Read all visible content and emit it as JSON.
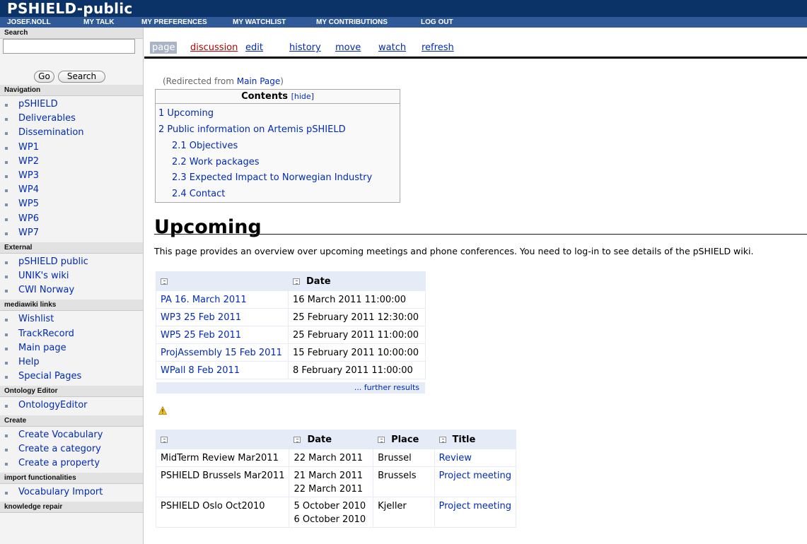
{
  "header": {
    "site_title": "PSHIELD-public",
    "personal": [
      "JOSEF.NOLL",
      "MY TALK",
      "MY PREFERENCES",
      "MY WATCHLIST",
      "MY CONTRIBUTIONS",
      "LOG OUT"
    ]
  },
  "sidebar": {
    "search": {
      "header": "Search",
      "go": "Go",
      "search": "Search",
      "value": ""
    },
    "navigation": {
      "header": "Navigation",
      "items": [
        "pSHIELD",
        "Deliverables",
        "Dissemination",
        "WP1",
        "WP2",
        "WP3",
        "WP4",
        "WP5",
        "WP6",
        "WP7"
      ]
    },
    "external": {
      "header": "External",
      "items": [
        "pSHIELD public",
        "UNIK's wiki",
        "CWI Norway"
      ]
    },
    "mediawiki": {
      "header": "mediawiki links",
      "items": [
        "Wishlist",
        "TrackRecord",
        "Main page",
        "Help",
        "Special Pages"
      ]
    },
    "ontology": {
      "header": "Ontology Editor",
      "items": [
        "OntologyEditor"
      ]
    },
    "create": {
      "header": "Create",
      "items": [
        "Create Vocabulary",
        "Create a category",
        "Create a property"
      ]
    },
    "import": {
      "header": "import functionalities",
      "items": [
        "Vocabulary Import"
      ]
    },
    "knowledge": {
      "header": "knowledge repair"
    }
  },
  "tabs": [
    "page",
    "discussion",
    "edit",
    "history",
    "move",
    "watch",
    "refresh"
  ],
  "content": {
    "redirect_prefix": "(Redirected from ",
    "redirect_link": "Main Page",
    "redirect_suffix": ")",
    "toc": {
      "title": "Contents",
      "hide": "[hide]",
      "items": [
        "1 Upcoming",
        "2 Public information on Artemis pSHIELD",
        "2.1 Objectives",
        "2.2 Work packages",
        "2.3 Expected Impact to Norwegian Industry",
        "2.4 Contact"
      ]
    },
    "heading": "Upcoming",
    "intro": "This page provides an overview over upcoming meetings and phone conferences. You need to log-in to see details of the pSHIELD wiki.",
    "table1": {
      "headers": [
        "",
        "Date"
      ],
      "rows": [
        [
          "PA 16. March 2011",
          "16 March 2011 11:00:00"
        ],
        [
          "WP3 25 Feb 2011",
          "25 February 2011 12:30:00"
        ],
        [
          "WP5 25 Feb 2011",
          "25 February 2011 11:00:00"
        ],
        [
          "ProjAssembly 15 Feb 2011",
          "15 February 2011 10:00:00"
        ],
        [
          "WPall 8 Feb 2011",
          "8 February 2011 11:00:00"
        ]
      ],
      "further": "... further results"
    },
    "table2": {
      "headers": [
        "",
        "Date",
        "Place",
        "Title"
      ],
      "rows": [
        [
          "MidTerm Review Mar2011",
          "22 March 2011",
          "",
          "Brussel",
          "Review"
        ],
        [
          "PSHIELD Brussels Mar2011",
          "21 March 2011",
          "22 March 2011",
          "Brussels",
          "Project meeting"
        ],
        [
          "PSHIELD Oslo Oct2010",
          "5 October 2010",
          "6 October 2010",
          "Kjeller",
          "Project meeting"
        ]
      ]
    }
  }
}
